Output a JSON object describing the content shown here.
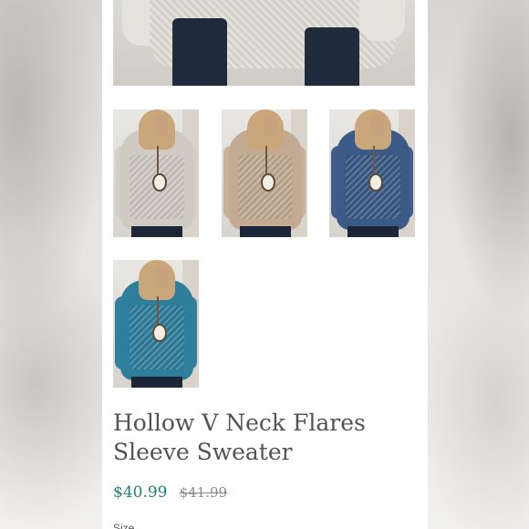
{
  "product": {
    "title_line1": "Hollow V Neck Flares",
    "title_line2": "Sleeve Sweater",
    "price_sale": "$40.99",
    "price_original": "$41.99",
    "size_label": "Size"
  },
  "thumbnails": [
    {
      "color_name": "light-gray",
      "color": "#cfcac2"
    },
    {
      "color_name": "khaki",
      "color": "#c2ab92"
    },
    {
      "color_name": "navy-blue",
      "color": "#3b5a86"
    },
    {
      "color_name": "teal-blue",
      "color": "#2f7f9c"
    }
  ],
  "colors": {
    "sale_price": "#1f7f7a",
    "title_text": "#535353",
    "original_price": "#8a8a8a"
  }
}
